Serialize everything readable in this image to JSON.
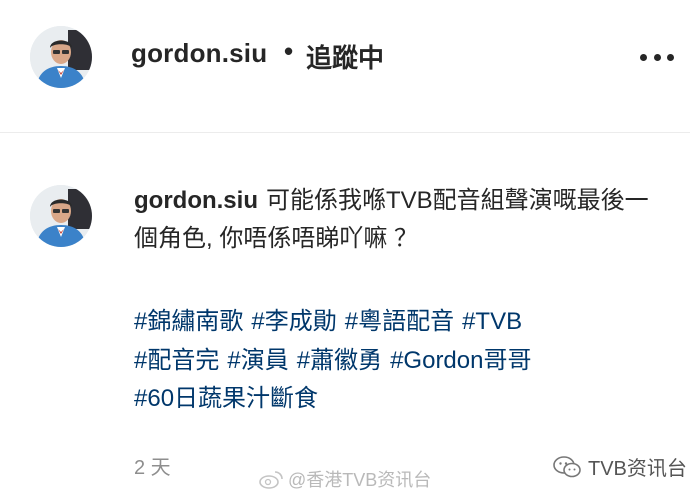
{
  "header": {
    "username": "gordon.siu",
    "separator": "•",
    "follow_status": "追蹤中",
    "more_icon": "more-horizontal-icon"
  },
  "comment": {
    "username": "gordon.siu",
    "text": "可能係我喺TVB配音組聲演嘅最後一個角色, 你唔係唔睇吖嘛 ？",
    "hashtags": [
      "#錦繡南歌",
      "#李成勛",
      "#粵語配音",
      "#TVB",
      "#配音完",
      "#演員",
      "#蕭徽勇",
      "#Gordon哥哥",
      "#60日蔬果汁斷食"
    ],
    "timestamp": "2 天"
  },
  "watermarks": {
    "weibo": "@香港TVB资讯台",
    "wechat": "TVB资讯台"
  },
  "colors": {
    "text": "#262626",
    "hashtag": "#00376b",
    "muted": "#8e8e8e",
    "divider": "#ececec"
  }
}
